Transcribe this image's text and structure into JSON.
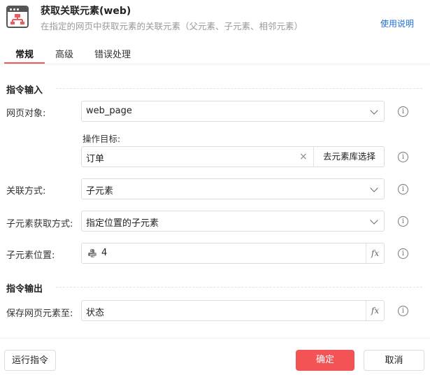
{
  "header": {
    "title": "获取关联元素(web)",
    "subtitle": "在指定的网页中获取元素的关联元素（父元素、子元素、相邻元素）",
    "help_link": "使用说明",
    "icon": "web-element-icon"
  },
  "tabs": [
    {
      "label": "常规",
      "active": true
    },
    {
      "label": "高级",
      "active": false
    },
    {
      "label": "错误处理",
      "active": false
    }
  ],
  "sections": {
    "input_title": "指令输入",
    "output_title": "指令输出"
  },
  "fields": {
    "web_page": {
      "label": "网页对象:",
      "value": "web_page"
    },
    "target": {
      "label": "操作目标:",
      "value": "订单",
      "clear_icon": "×",
      "library_button": "去元素库选择"
    },
    "relation": {
      "label": "关联方式:",
      "value": "子元素"
    },
    "child_method": {
      "label": "子元素获取方式:",
      "value": "指定位置的子元素"
    },
    "child_position": {
      "label": "子元素位置:",
      "value": "4",
      "fx": "fx"
    },
    "save_to": {
      "label": "保存网页元素至:",
      "value": "状态",
      "fx": "fx"
    }
  },
  "info_icon": "i",
  "footer": {
    "run_label": "运行指令",
    "ok_label": "确定",
    "cancel_label": "取消"
  },
  "colors": {
    "accent": "#f05a5a",
    "primary_button": "#f45356",
    "link": "#1e6fd9"
  }
}
